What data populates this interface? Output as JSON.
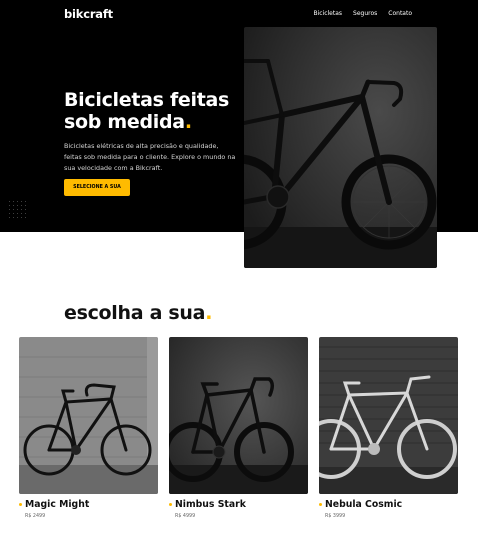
{
  "brand": {
    "logo": "bikcraft",
    "accent": "#ffbb00"
  },
  "nav": [
    {
      "label": "Bicicletas"
    },
    {
      "label": "Seguros"
    },
    {
      "label": "Contato"
    }
  ],
  "hero": {
    "title_line1": "Bicicletas feitas",
    "title_line2": "sob medida",
    "title_dot": ".",
    "text": "Bicicletas elétricas de alta precisão e qualidade, feitas sob medida para o cliente. Explore o mundo na sua velocidade com a Bikcraft.",
    "button_label": "SELECIONE A SUA"
  },
  "products_section": {
    "title": "escolha a sua",
    "title_dot": ".",
    "items": [
      {
        "name": "Magic Might",
        "price": "R$ 2499"
      },
      {
        "name": "Nimbus Stark",
        "price": "R$ 4999"
      },
      {
        "name": "Nebula Cosmic",
        "price": "R$ 3999"
      }
    ]
  }
}
